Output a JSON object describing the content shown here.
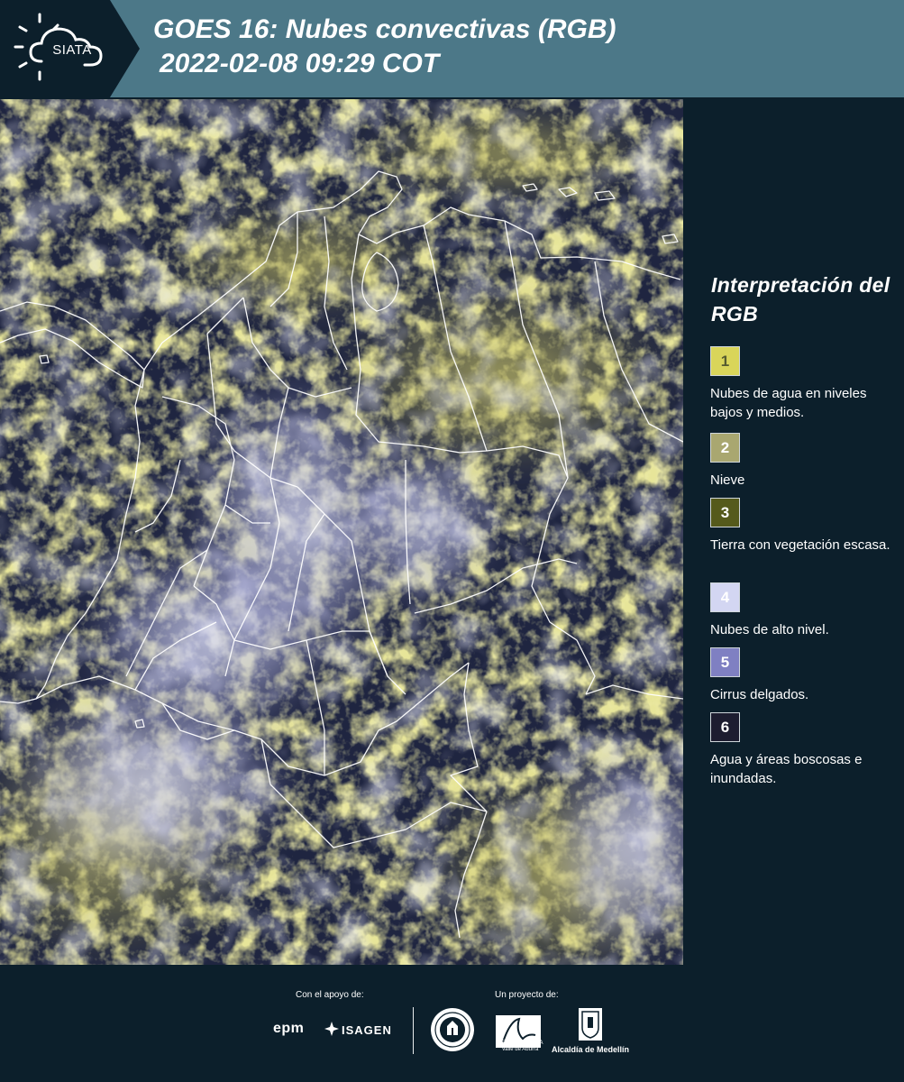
{
  "header": {
    "logo_text": "SIATA",
    "title": "GOES 16: Nubes convectivas (RGB)",
    "subtitle": "2022-02-08 09:29 COT"
  },
  "legend": {
    "title": "Interpretación del RGB",
    "items": [
      {
        "number": "1",
        "label": "Nubes de agua en niveles bajos y medios.",
        "color": "#d9d55a"
      },
      {
        "number": "2",
        "label": "Nieve",
        "color": "#a9a770"
      },
      {
        "number": "3",
        "label": "Tierra con vegetación escasa.",
        "color": "#555a1c"
      },
      {
        "number": "4",
        "label": "Nubes de alto nivel.",
        "color": "#d3d6f2"
      },
      {
        "number": "5",
        "label": "Cirrus delgados.",
        "color": "#7f80c2"
      },
      {
        "number": "6",
        "label": "Agua y áreas boscosas e inundadas.",
        "color": "#1d1d30"
      }
    ]
  },
  "footer": {
    "support_label": "Con el apoyo de:",
    "project_label": "Un proyecto de:",
    "sponsors": [
      "epm",
      "ISAGEN"
    ],
    "partners": {
      "amva": "METROPOLITANA Valle de Aburrá",
      "medellin": "Alcaldía de Medellín"
    }
  },
  "colors": {
    "header_bg": "#4c7888",
    "page_bg": "#0c1f2b",
    "map_water": "#1d2338",
    "cloud_low": "#c9c35a",
    "cloud_high": "#c8cbee",
    "border": "#ffffff"
  }
}
